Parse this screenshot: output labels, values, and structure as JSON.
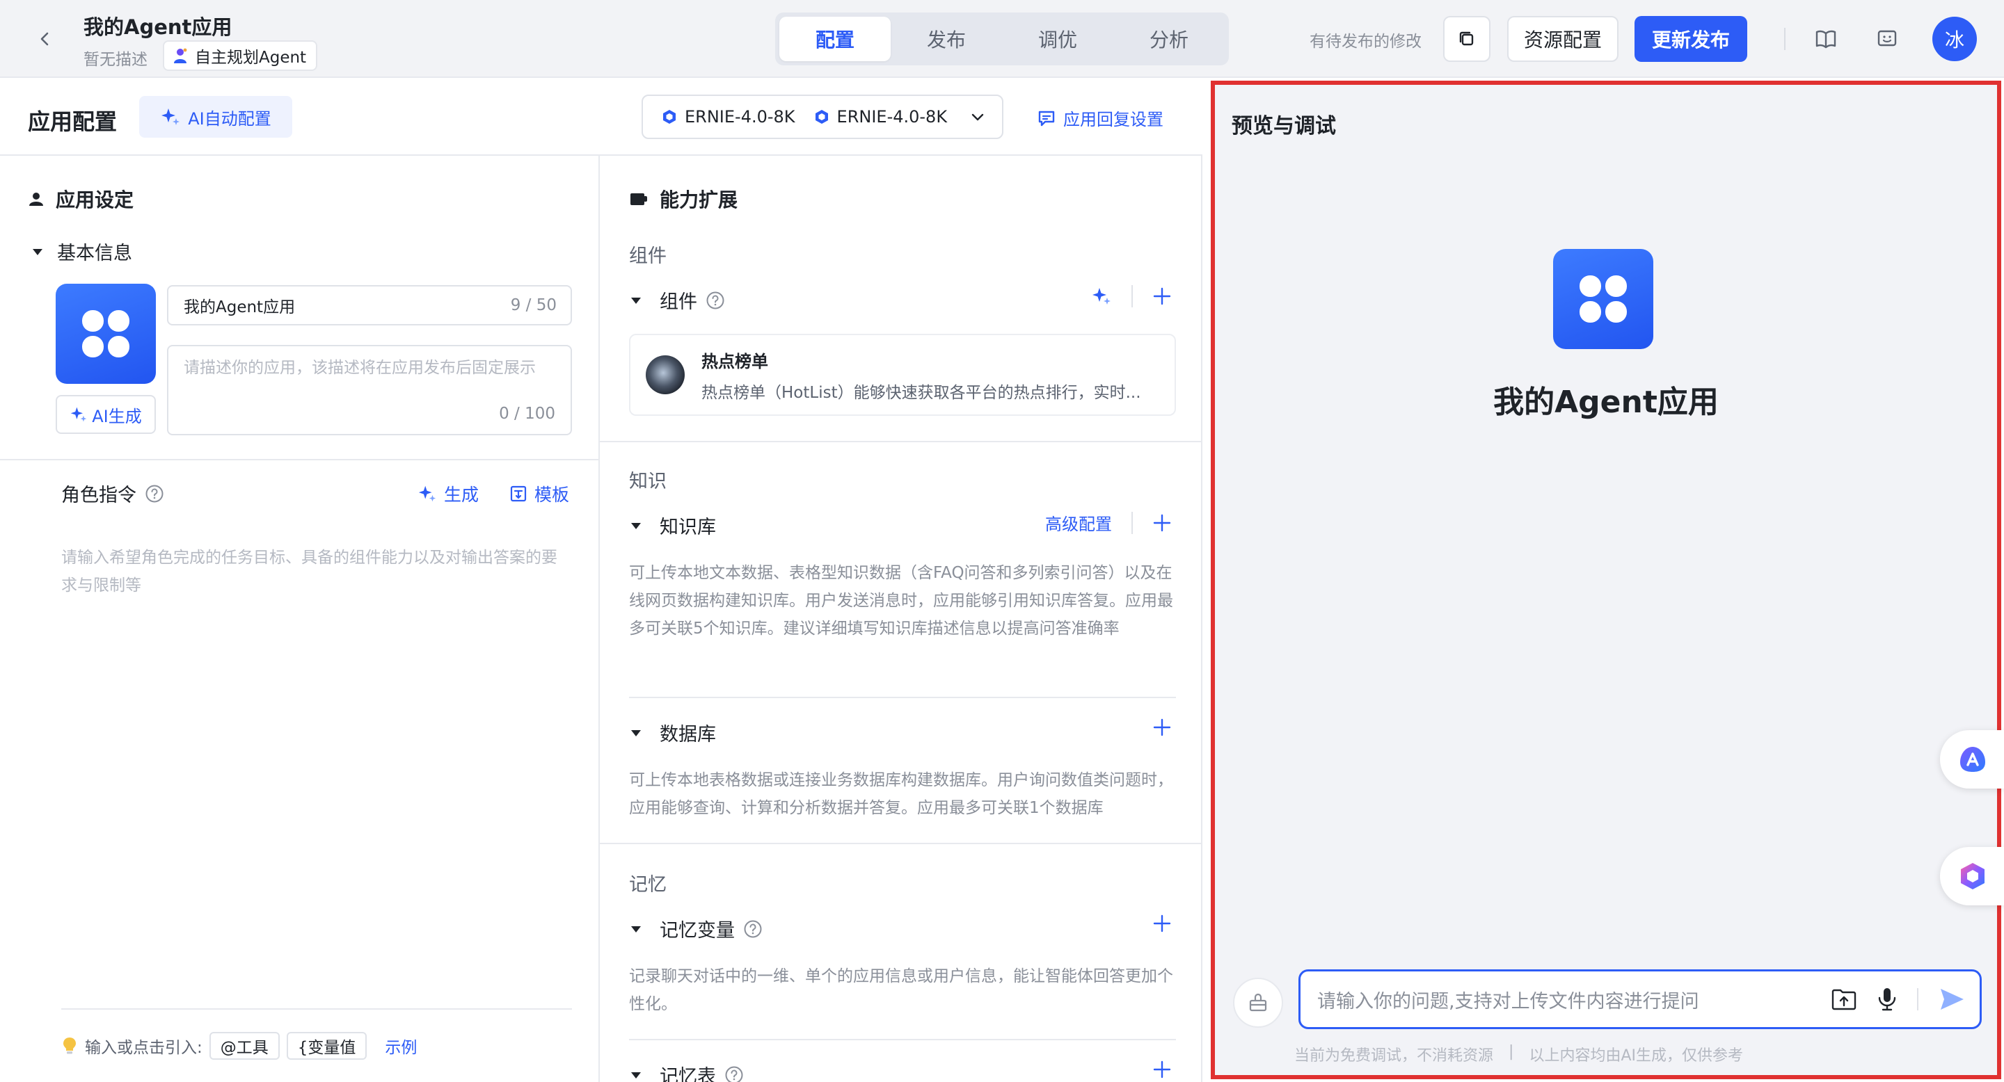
{
  "header": {
    "app_title": "我的Agent应用",
    "app_desc": "暂无描述",
    "agent_type": "自主规划Agent",
    "tabs": [
      {
        "label": "配置",
        "active": true
      },
      {
        "label": "发布",
        "active": false
      },
      {
        "label": "调优",
        "active": false
      },
      {
        "label": "分析",
        "active": false
      }
    ],
    "pending_text": "有待发布的修改",
    "resource_label": "资源配置",
    "publish_label": "更新发布",
    "avatar_text": "冰"
  },
  "config": {
    "title": "应用配置",
    "ai_auto_label": "AI自动配置",
    "models": [
      "ERNIE-4.0-8K",
      "ERNIE-4.0-8K"
    ],
    "reply_settings_label": "应用回复设置"
  },
  "left": {
    "section_title": "应用设定",
    "basic_info_title": "基本信息",
    "name_value": "我的Agent应用",
    "name_count": "9 / 50",
    "desc_placeholder": "请描述你的应用，该描述将在应用发布后固定展示",
    "desc_count": "0 / 100",
    "ai_gen_label": "AI生成",
    "role_title": "角色指令",
    "role_generate": "生成",
    "role_template": "模板",
    "role_placeholder": "请输入希望角色完成的任务目标、具备的组件能力以及对输出答案的要求与限制等",
    "insert_hint": "输入或点击引入:",
    "insert_tool": "@工具",
    "insert_var": "{变量值",
    "insert_example": "示例"
  },
  "middle": {
    "section_title": "能力扩展",
    "components_group": "组件",
    "components_title": "组件",
    "plugin_name": "热点榜单",
    "plugin_desc": "热点榜单（HotList）能够快速获取各平台的热点排行，实时...",
    "knowledge_group": "知识",
    "kb_title": "知识库",
    "kb_advanced": "高级配置",
    "kb_desc": "可上传本地文本数据、表格型知识数据（含FAQ问答和多列索引问答）以及在线网页数据构建知识库。用户发送消息时，应用能够引用知识库答复。应用最多可关联5个知识库。建议详细填写知识库描述信息以提高问答准确率",
    "db_title": "数据库",
    "db_desc": "可上传本地表格数据或连接业务数据库构建数据库。用户询问数值类问题时，应用能够查询、计算和分析数据并答复。应用最多可关联1个数据库",
    "memory_group": "记忆",
    "mem_var_title": "记忆变量",
    "mem_var_desc": "记录聊天对话中的一维、单个的应用信息或用户信息，能让智能体回答更加个性化。",
    "mem_table_title": "记忆表"
  },
  "preview": {
    "title": "预览与调试",
    "app_name": "我的Agent应用",
    "input_placeholder": "请输入你的问题,支持对上传文件内容进行提问",
    "footer_left": "当前为免费调试，不消耗资源",
    "footer_sep": "|",
    "footer_right": "以上内容均由AI生成，仅供参考"
  },
  "colors": {
    "primary": "#2d5cf6",
    "highlight_border": "#e03131"
  }
}
